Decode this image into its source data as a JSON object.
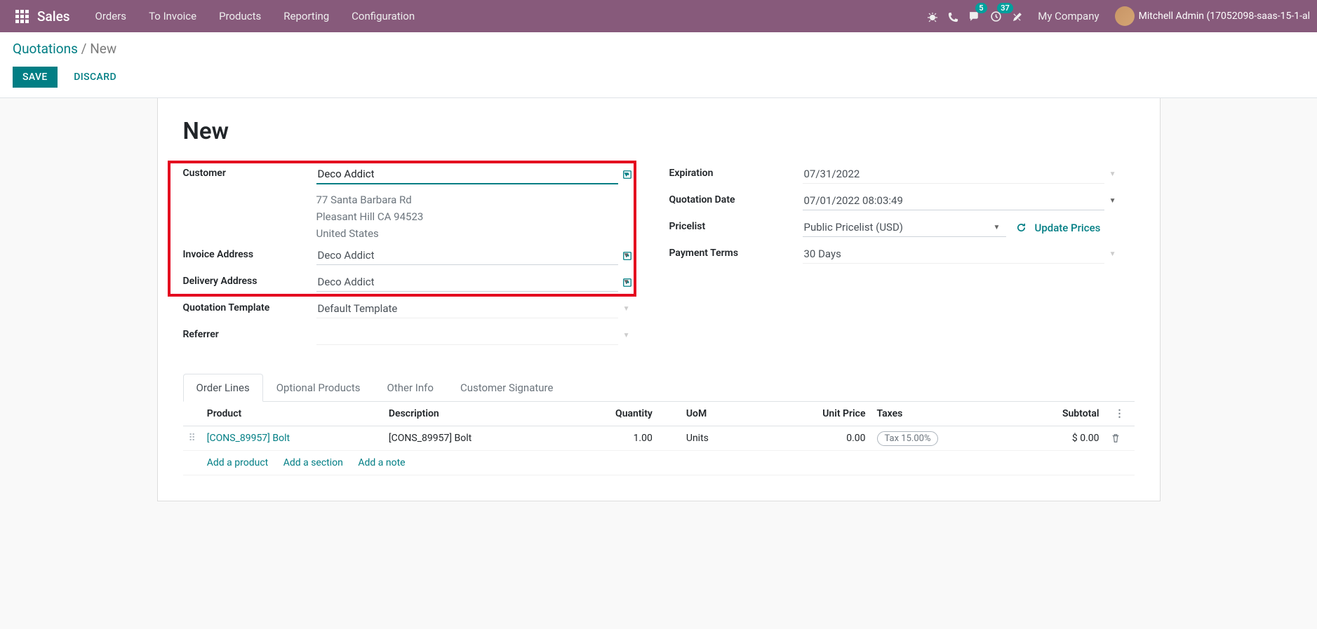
{
  "nav": {
    "brand": "Sales",
    "menu": [
      "Orders",
      "To Invoice",
      "Products",
      "Reporting",
      "Configuration"
    ],
    "msg_count": "5",
    "activity_count": "37",
    "company": "My Company",
    "user": "Mitchell Admin (17052098-saas-15-1-al"
  },
  "breadcrumb": {
    "parent": "Quotations",
    "current": "New"
  },
  "actions": {
    "save": "SAVE",
    "discard": "DISCARD"
  },
  "title": "New",
  "left": {
    "customer_label": "Customer",
    "customer": "Deco Addict",
    "addr1": "77 Santa Barbara Rd",
    "addr2": "Pleasant Hill CA 94523",
    "addr3": "United States",
    "invoice_label": "Invoice Address",
    "invoice": "Deco Addict",
    "delivery_label": "Delivery Address",
    "delivery": "Deco Addict",
    "qtmpl_label": "Quotation Template",
    "qtmpl": "Default Template",
    "referrer_label": "Referrer",
    "referrer": ""
  },
  "right": {
    "expiration_label": "Expiration",
    "expiration": "07/31/2022",
    "qdate_label": "Quotation Date",
    "qdate": "07/01/2022 08:03:49",
    "pricelist_label": "Pricelist",
    "pricelist": "Public Pricelist (USD)",
    "update_prices": "Update Prices",
    "pterms_label": "Payment Terms",
    "pterms": "30 Days"
  },
  "tabs": [
    "Order Lines",
    "Optional Products",
    "Other Info",
    "Customer Signature"
  ],
  "table": {
    "headers": {
      "product": "Product",
      "description": "Description",
      "qty": "Quantity",
      "uom": "UoM",
      "unit_price": "Unit Price",
      "taxes": "Taxes",
      "subtotal": "Subtotal"
    },
    "row": {
      "product": "[CONS_89957] Bolt",
      "description": "[CONS_89957] Bolt",
      "qty": "1.00",
      "uom": "Units",
      "unit_price": "0.00",
      "tax": "Tax 15.00%",
      "subtotal": "$ 0.00"
    },
    "add_product": "Add a product",
    "add_section": "Add a section",
    "add_note": "Add a note"
  }
}
